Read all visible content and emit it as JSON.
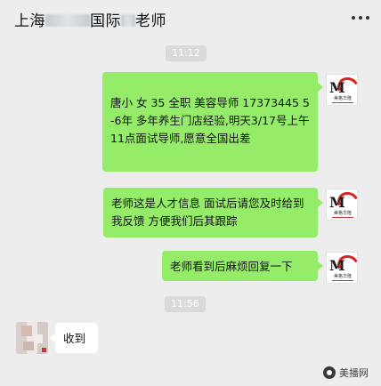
{
  "header": {
    "title_part1": "上海",
    "title_part2": "国际",
    "title_part3": "老师",
    "more_icon": "more-dots-icon"
  },
  "messages": [
    {
      "type": "time",
      "text": "11:12"
    },
    {
      "type": "sent",
      "text": "唐小 女 35 全职 美容导师 17373445 5-6年 多年养生门店经验,明天3/17号上午11点面试导师,愿意全国出差"
    },
    {
      "type": "sent",
      "text": "老师这是人才信息  面试后请您及时给到我反馈  方便我们后其跟踪"
    },
    {
      "type": "sent",
      "text": "老师看到后麻烦回复一下"
    },
    {
      "type": "time",
      "text": "11:56"
    },
    {
      "type": "received",
      "text": "收到"
    }
  ],
  "sender_avatar": {
    "caption": "美格华隆"
  },
  "watermark": {
    "text": "美播网"
  }
}
